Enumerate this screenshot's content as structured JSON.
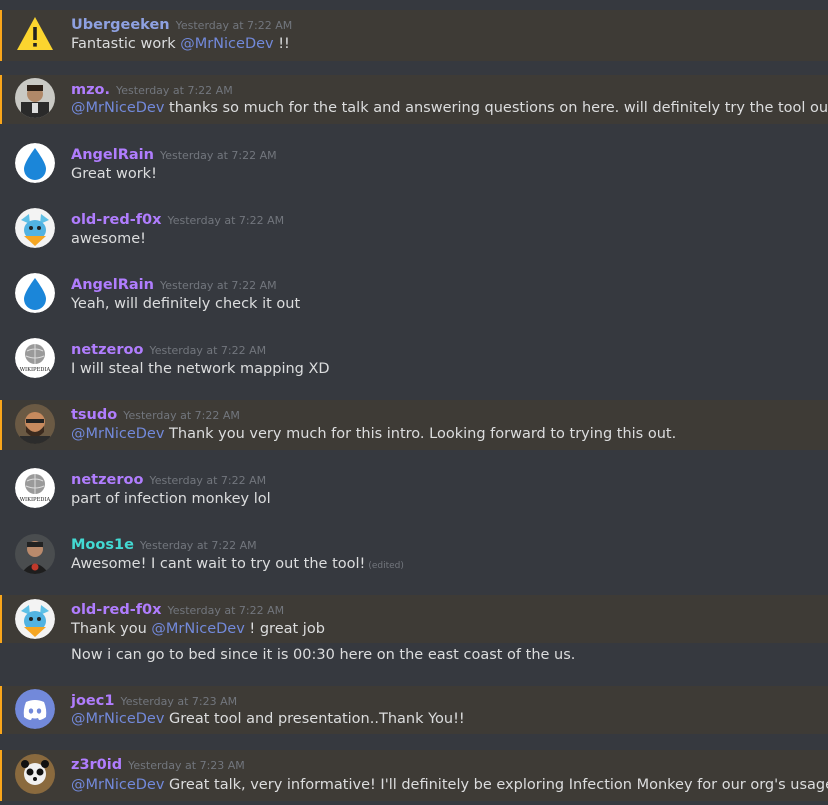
{
  "colors": {
    "background": "#36393f",
    "mention_highlight": "#3e3b36",
    "mention_bar": "#faa61a",
    "mention_text": "#7289da",
    "timestamp": "#72767d",
    "purple_user": "#b07dfe",
    "blue_user": "#8ea1e1",
    "teal_user": "#43d9d2"
  },
  "messages": [
    {
      "user": "Ubergeeken",
      "time": "Yesterday at 7:22 AM",
      "avatar": "warning-icon",
      "pre": "Fantastic work ",
      "mention": "@MrNiceDev",
      "post": " !!"
    },
    {
      "user": "mzo.",
      "time": "Yesterday at 7:22 AM",
      "avatar": "user-photo",
      "mention": "@MrNiceDev",
      "post": " thanks so much for the talk and answering questions on here. will definitely try the tool out!"
    },
    {
      "user": "AngelRain",
      "time": "Yesterday at 7:22 AM",
      "avatar": "water-drop-icon",
      "text": "Great work!"
    },
    {
      "user": "old-red-f0x",
      "time": "Yesterday at 7:22 AM",
      "avatar": "cartoon-creature-icon",
      "text": "awesome!"
    },
    {
      "user": "AngelRain",
      "time": "Yesterday at 7:22 AM",
      "avatar": "water-drop-icon",
      "text": "Yeah, will definitely check it out"
    },
    {
      "user": "netzeroo",
      "time": "Yesterday at 7:22 AM",
      "avatar": "wikipedia-globe-icon",
      "avatar_text": "WIKIPEDIA",
      "text": "I will steal the network mapping XD"
    },
    {
      "user": "tsudo",
      "time": "Yesterday at 7:22 AM",
      "avatar": "user-photo",
      "mention": "@MrNiceDev",
      "post": " Thank you very much for this intro. Looking forward to trying this out."
    },
    {
      "user": "netzeroo",
      "time": "Yesterday at 7:22 AM",
      "avatar": "wikipedia-globe-icon",
      "avatar_text": "WIKIPEDIA",
      "text": "part of infection monkey lol"
    },
    {
      "user": "Moos1e",
      "time": "Yesterday at 7:22 AM",
      "avatar": "user-photo",
      "text": "Awesome! I cant wait to try out the tool!",
      "edited": "(edited)"
    },
    {
      "user": "old-red-f0x",
      "time": "Yesterday at 7:22 AM",
      "avatar": "cartoon-creature-icon",
      "pre": "Thank you ",
      "mention": "@MrNiceDev",
      "post": " ! great job",
      "text2": "Now i can go to bed since it is 00:30 here on the east coast of the us."
    },
    {
      "user": "joec1",
      "time": "Yesterday at 7:23 AM",
      "avatar": "discord-logo-icon",
      "mention": "@MrNiceDev",
      "post": " Great tool and presentation..Thank You!!"
    },
    {
      "user": "z3r0id",
      "time": "Yesterday at 7:23 AM",
      "avatar": "user-photo",
      "mention": "@MrNiceDev",
      "post": " Great talk, very informative! I'll definitely be exploring Infection Monkey for our org's usage."
    }
  ]
}
